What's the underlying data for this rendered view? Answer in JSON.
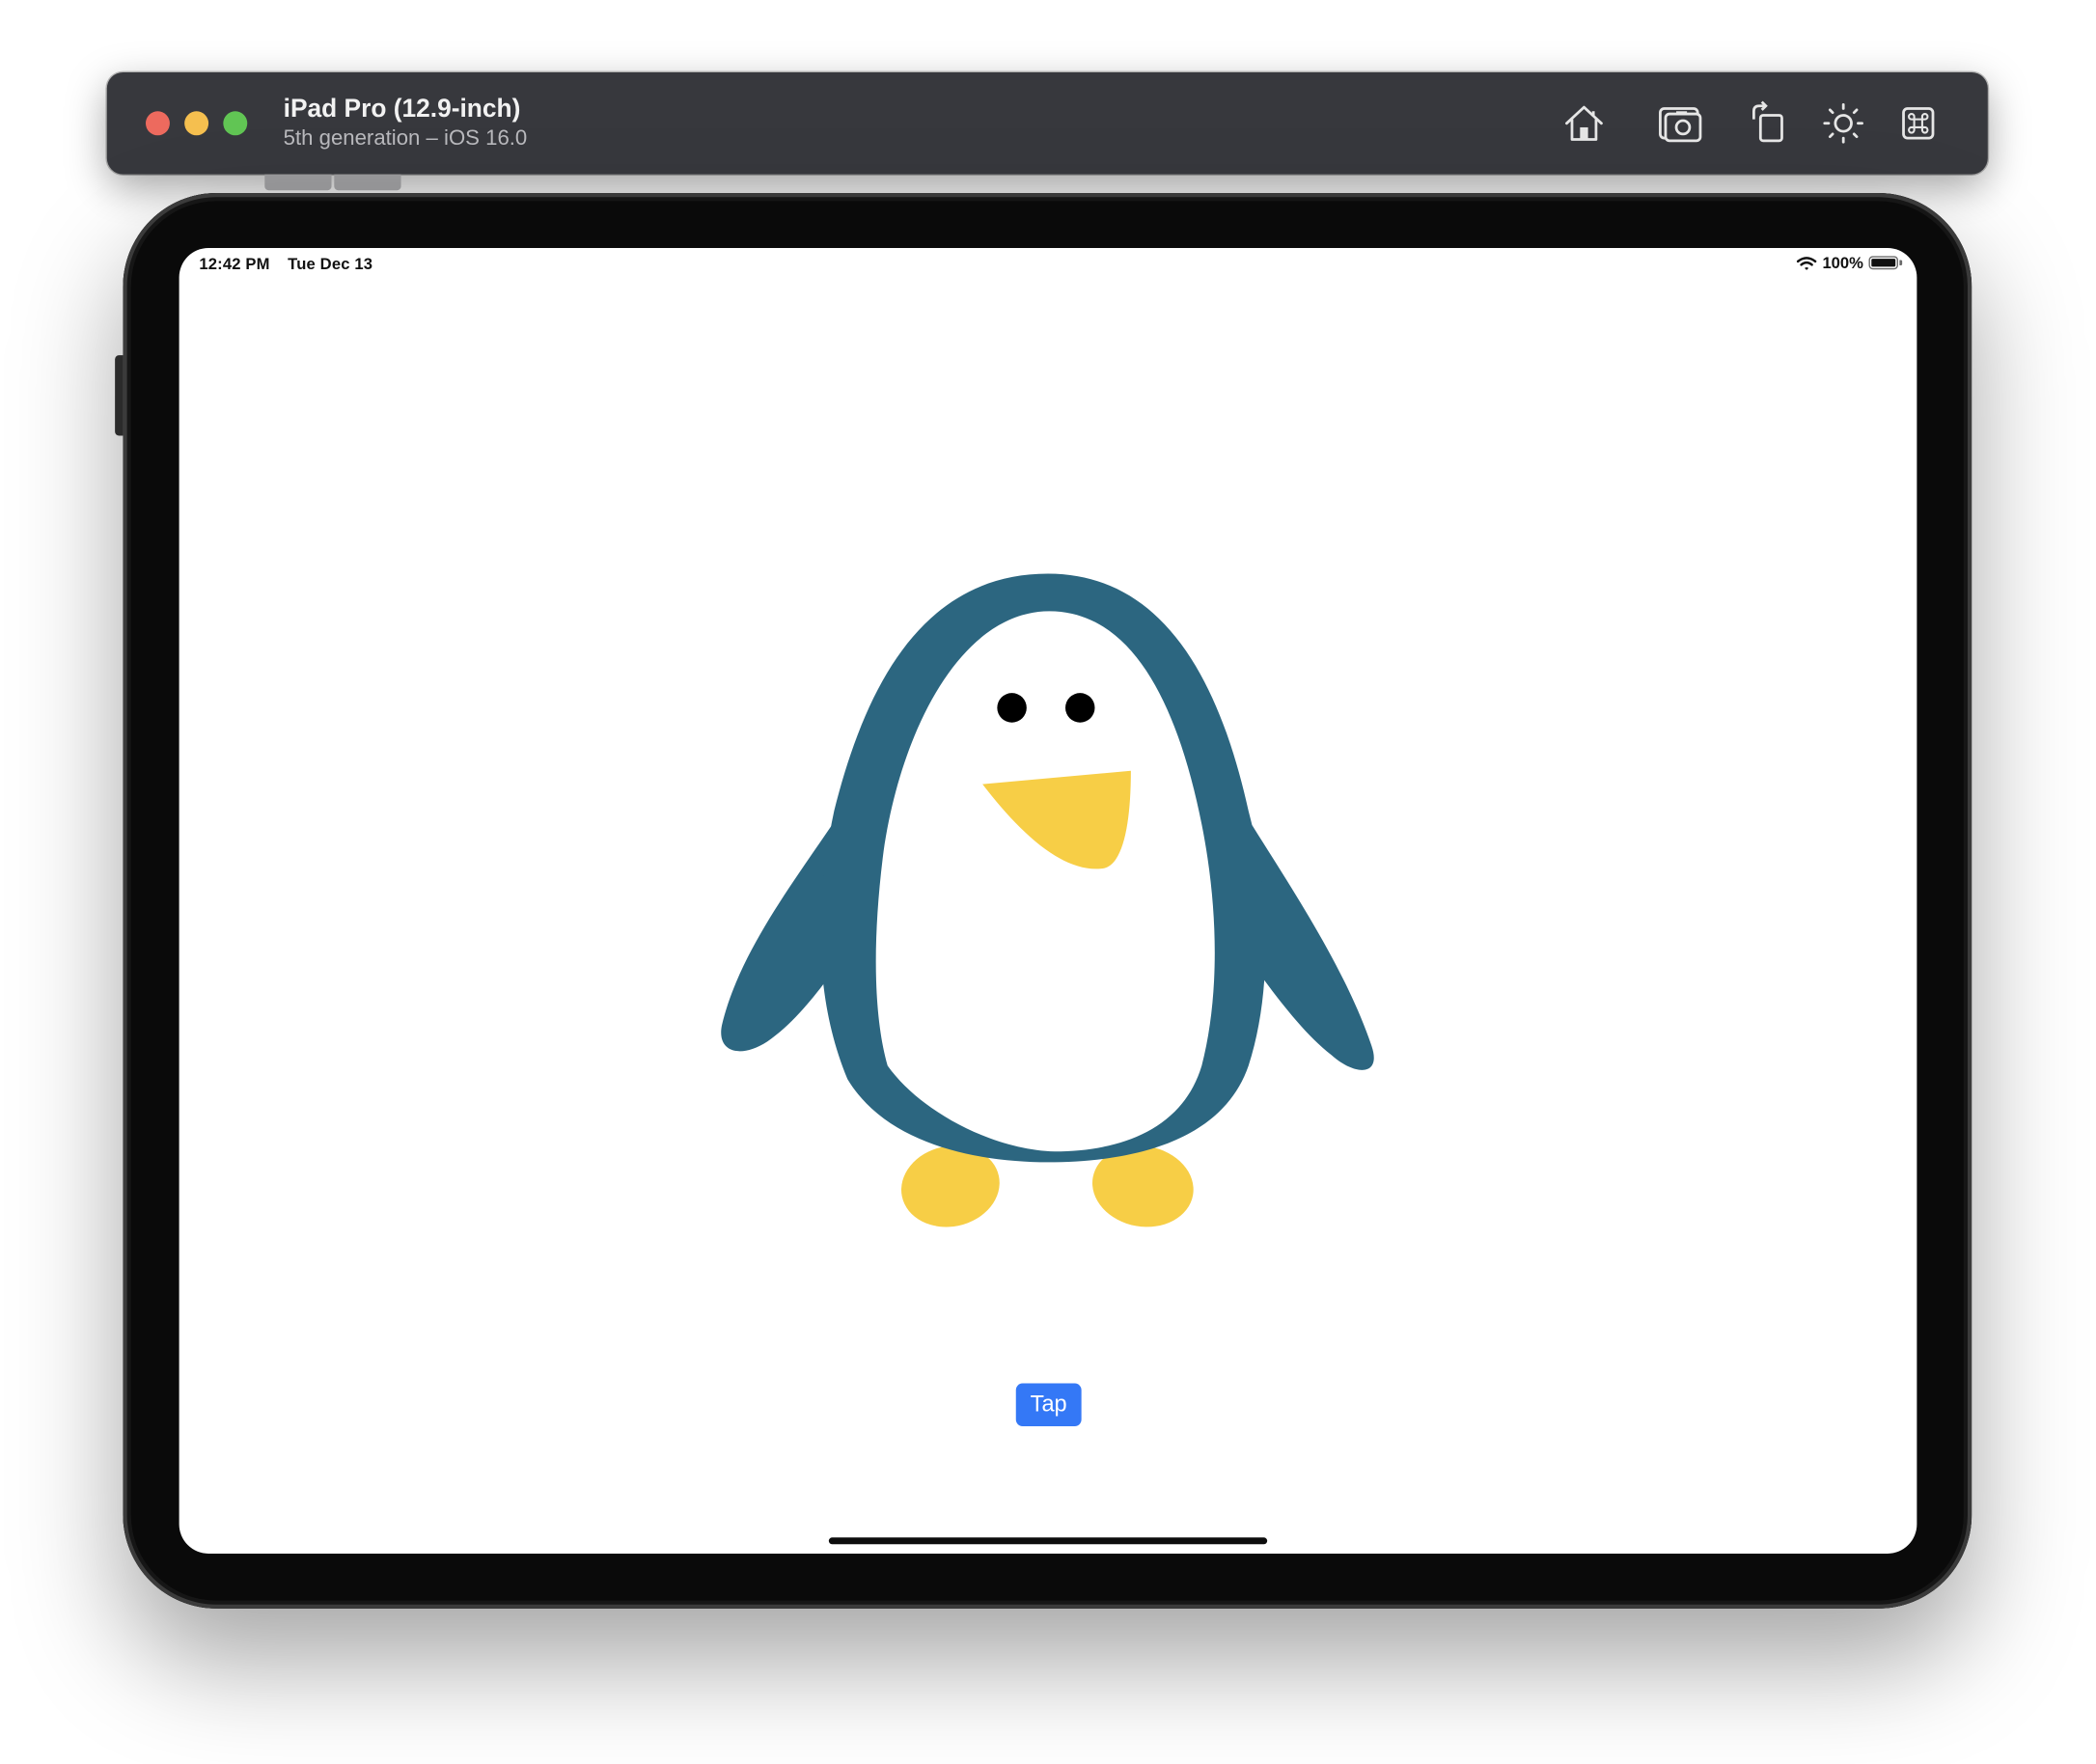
{
  "window": {
    "device_name": "iPad Pro (12.9-inch)",
    "device_subtitle": "5th generation – iOS 16.0",
    "toolbar_icons": [
      "home-icon",
      "screenshot-icon",
      "rotate-icon",
      "appearance-icon",
      "command-icon"
    ]
  },
  "status_bar": {
    "time": "12:42 PM",
    "date": "Tue Dec 13",
    "battery": "100%"
  },
  "app": {
    "illustration": "penguin",
    "button_label": "Tap"
  },
  "colors": {
    "penguin_body": "#2c6680",
    "penguin_belly": "#ffffff",
    "penguin_beak_feet": "#f7ce46",
    "penguin_eyes": "#000000",
    "button_accent": "#3478f6"
  }
}
